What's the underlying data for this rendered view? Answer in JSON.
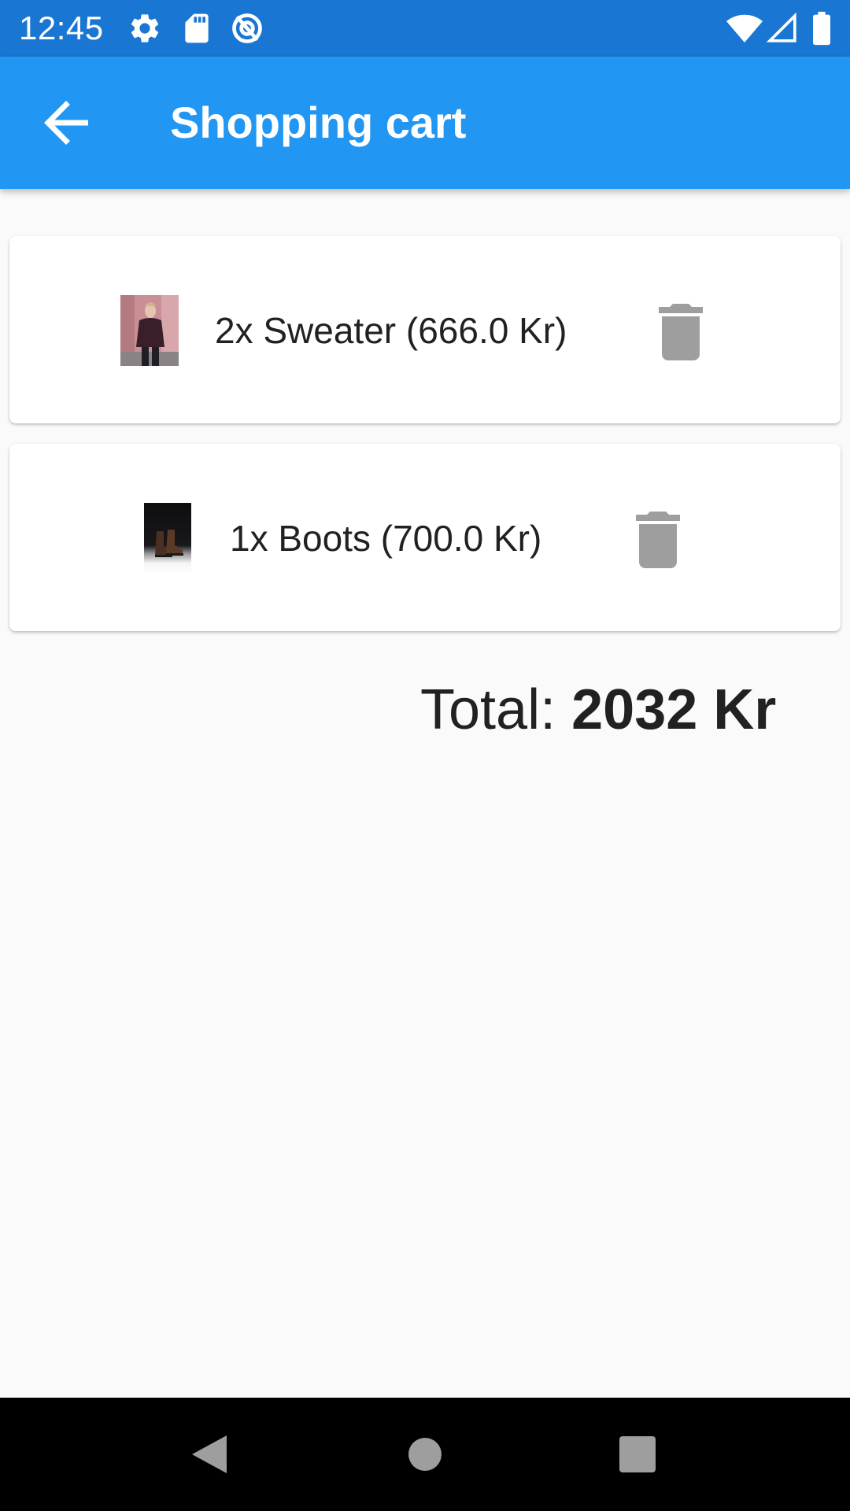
{
  "status_bar": {
    "time": "12:45",
    "background": "#1976d2",
    "left_icons": [
      "gear-icon",
      "sd-card-icon",
      "sync-disabled-icon"
    ],
    "right_icons": [
      "wifi-icon",
      "cell-signal-icon",
      "battery-icon"
    ]
  },
  "app_bar": {
    "title": "Shopping cart",
    "background": "#2196f3",
    "back_icon": "arrow-back-icon"
  },
  "cart": {
    "items": [
      {
        "label": "2x Sweater (666.0 Kr)",
        "thumbnail": "sweater-photo",
        "delete_icon": "trash-icon"
      },
      {
        "label": "1x Boots (700.0 Kr)",
        "thumbnail": "boots-photo",
        "delete_icon": "trash-icon"
      }
    ],
    "total_prefix": "Total:",
    "total_amount": "2032 Kr"
  },
  "nav_bar": {
    "buttons": [
      "back-triangle-icon",
      "home-circle-icon",
      "recents-square-icon"
    ]
  },
  "colors": {
    "primary": "#2196f3",
    "primary_dark": "#1976d2",
    "icon_grey": "#9e9e9e",
    "text": "#212121",
    "background": "#fafafa"
  }
}
